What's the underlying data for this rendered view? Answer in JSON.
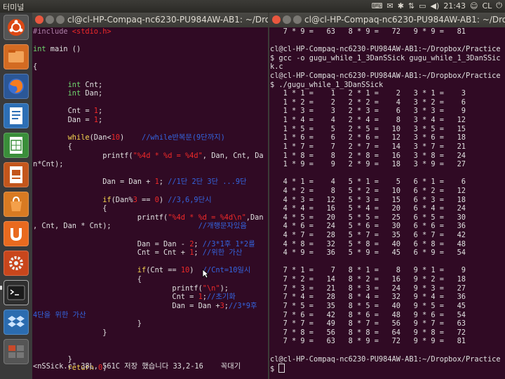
{
  "topbar": {
    "app_title": "터미널",
    "time": "21:43",
    "user": "CL"
  },
  "left_window": {
    "title": "cl@cl-HP-Compaq-nc6230-PU984AW-AB1: ~/Dropbox/",
    "code": [
      [
        [
          "#include ",
          "pp"
        ],
        [
          "<stdio.h>",
          "str"
        ]
      ],
      [],
      [
        [
          "int",
          "type"
        ],
        [
          " main ()",
          ""
        ]
      ],
      [],
      [
        [
          "{",
          ""
        ]
      ],
      [],
      [
        [
          "        ",
          ""
        ],
        [
          "int",
          "type"
        ],
        [
          " Cnt;",
          ""
        ]
      ],
      [
        [
          "        ",
          ""
        ],
        [
          "int",
          "type"
        ],
        [
          " Dan;",
          ""
        ]
      ],
      [],
      [
        [
          "        Cnt = ",
          ""
        ],
        [
          "1",
          "num"
        ],
        [
          ";",
          ""
        ]
      ],
      [
        [
          "        Dan = ",
          ""
        ],
        [
          "1",
          "num"
        ],
        [
          ";",
          ""
        ]
      ],
      [],
      [
        [
          "        ",
          ""
        ],
        [
          "while",
          "kw"
        ],
        [
          "(Dan<",
          ""
        ],
        [
          "10",
          "num"
        ],
        [
          ")    ",
          ""
        ],
        [
          "//while반복문(9단까지)",
          "cm"
        ]
      ],
      [
        [
          "        {",
          ""
        ]
      ],
      [
        [
          "                printf(",
          ""
        ],
        [
          "\"%4d * %d = %4d\"",
          "str"
        ],
        [
          ", Dan, Cnt, Da",
          ""
        ]
      ],
      [
        [
          "n*Cnt);",
          ""
        ]
      ],
      [],
      [
        [
          "                Dan = Dan + ",
          ""
        ],
        [
          "1",
          "num"
        ],
        [
          "; ",
          ""
        ],
        [
          "//1단 2단 3단 ...9단",
          "cm"
        ]
      ],
      [],
      [
        [
          "                ",
          ""
        ],
        [
          "if",
          "kw"
        ],
        [
          "(Dan%",
          ""
        ],
        [
          "3",
          "num"
        ],
        [
          " == ",
          ""
        ],
        [
          "0",
          "num"
        ],
        [
          ") ",
          ""
        ],
        [
          "//3,6,9단시",
          "cm"
        ]
      ],
      [
        [
          "                {",
          ""
        ]
      ],
      [
        [
          "                        printf(",
          ""
        ],
        [
          "\"%4d * %d = %4d\\n\"",
          "str"
        ],
        [
          ",Dan",
          ""
        ]
      ],
      [
        [
          ", Cnt, Dan * Cnt);",
          ""
        ],
        [
          "                    //개행문자있음",
          "cm"
        ]
      ],
      [],
      [
        [
          "                        Dan = Dan - ",
          ""
        ],
        [
          "2",
          "num"
        ],
        [
          "; ",
          ""
        ],
        [
          "//3*1후 1*2를",
          "cm"
        ]
      ],
      [
        [
          "                        Cnt = Cnt + ",
          ""
        ],
        [
          "1",
          "num"
        ],
        [
          "; ",
          ""
        ],
        [
          "//위한 가산",
          "cm"
        ]
      ],
      [],
      [
        [
          "                        ",
          ""
        ],
        [
          "if",
          "kw"
        ],
        [
          "(Cnt == ",
          ""
        ],
        [
          "10",
          "num"
        ],
        [
          ")  ",
          ""
        ],
        [
          "//Cnt=10일시",
          "cm"
        ]
      ],
      [
        [
          "                        {",
          ""
        ]
      ],
      [
        [
          "                                printf(",
          ""
        ],
        [
          "\"\\n\"",
          "str"
        ],
        [
          ");",
          ""
        ]
      ],
      [
        [
          "                                Cnt = ",
          ""
        ],
        [
          "1",
          "num"
        ],
        [
          ";",
          ""
        ],
        [
          "//초기화",
          "cm"
        ]
      ],
      [
        [
          "                                Dan = Dan +",
          ""
        ],
        [
          "3",
          "num"
        ],
        [
          ";",
          ""
        ],
        [
          "//3*9후",
          "cm"
        ]
      ],
      [
        [
          "4단을 위한 가산",
          "cm"
        ]
      ],
      [
        [
          "                        }",
          ""
        ]
      ],
      [
        [
          "                }",
          ""
        ]
      ],
      [],
      [],
      [
        [
          "        }",
          ""
        ]
      ],
      [
        [
          "        ",
          ""
        ],
        [
          "return",
          "kw"
        ],
        [
          " ",
          ""
        ],
        [
          "0",
          "num"
        ],
        [
          ";",
          ""
        ]
      ]
    ],
    "status_file": "<nSSick.c\" 38L, 561C 저장 했습니다",
    "status_pos": "33,2-16",
    "status_scroll": "꼭대기"
  },
  "right_window": {
    "title": "cl@cl-HP-Compaq-nc6230-PU984AW-AB1: ~/Dropbox/",
    "lines": [
      "   7 * 9 =   63   8 * 9 =   72   9 * 9 =   81",
      "",
      "cl@cl-HP-Compaq-nc6230-PU984AW-AB1:~/Dropbox/Practice",
      "$ gcc -o gugu_while_1_3DanSSick gugu_while_1_3DanSSic",
      "k.c",
      "cl@cl-HP-Compaq-nc6230-PU984AW-AB1:~/Dropbox/Practice",
      "$ ./gugu_while_1_3DanSSick",
      "   1 * 1 =    1   2 * 1 =    2   3 * 1 =    3",
      "   1 * 2 =    2   2 * 2 =    4   3 * 2 =    6",
      "   1 * 3 =    3   2 * 3 =    6   3 * 3 =    9",
      "   1 * 4 =    4   2 * 4 =    8   3 * 4 =   12",
      "   1 * 5 =    5   2 * 5 =   10   3 * 5 =   15",
      "   1 * 6 =    6   2 * 6 =   12   3 * 6 =   18",
      "   1 * 7 =    7   2 * 7 =   14   3 * 7 =   21",
      "   1 * 8 =    8   2 * 8 =   16   3 * 8 =   24",
      "   1 * 9 =    9   2 * 9 =   18   3 * 9 =   27",
      "",
      "   4 * 1 =    4   5 * 1 =    5   6 * 1 =    6",
      "   4 * 2 =    8   5 * 2 =   10   6 * 2 =   12",
      "   4 * 3 =   12   5 * 3 =   15   6 * 3 =   18",
      "   4 * 4 =   16   5 * 4 =   20   6 * 4 =   24",
      "   4 * 5 =   20   5 * 5 =   25   6 * 5 =   30",
      "   4 * 6 =   24   5 * 6 =   30   6 * 6 =   36",
      "   4 * 7 =   28   5 * 7 =   35   6 * 7 =   42",
      "   4 * 8 =   32   5 * 8 =   40   6 * 8 =   48",
      "   4 * 9 =   36   5 * 9 =   45   6 * 9 =   54",
      "",
      "   7 * 1 =    7   8 * 1 =    8   9 * 1 =    9",
      "   7 * 2 =   14   8 * 2 =   16   9 * 2 =   18",
      "   7 * 3 =   21   8 * 3 =   24   9 * 3 =   27",
      "   7 * 4 =   28   8 * 4 =   32   9 * 4 =   36",
      "   7 * 5 =   35   8 * 5 =   40   9 * 5 =   45",
      "   7 * 6 =   42   8 * 6 =   48   9 * 6 =   54",
      "   7 * 7 =   49   8 * 7 =   56   9 * 7 =   63",
      "   7 * 8 =   56   8 * 8 =   64   9 * 8 =   72",
      "   7 * 9 =   63   8 * 9 =   72   9 * 9 =   81",
      "",
      "cl@cl-HP-Compaq-nc6230-PU984AW-AB1:~/Dropbox/Practice",
      "$ "
    ]
  },
  "launcher": {
    "items": [
      "ubuntu-dash",
      "files",
      "firefox",
      "writer",
      "calc",
      "impress",
      "software-center",
      "ubuntu-one",
      "system-settings",
      "terminal",
      "dropbox",
      "workspace-switcher"
    ]
  },
  "colors": {
    "terminal_bg": "#300a24",
    "comment": "#3465e0",
    "keyword": "#f5d44f",
    "type": "#6fd86f",
    "string": "#ef2929",
    "preprocessor": "#ad7fa8"
  }
}
